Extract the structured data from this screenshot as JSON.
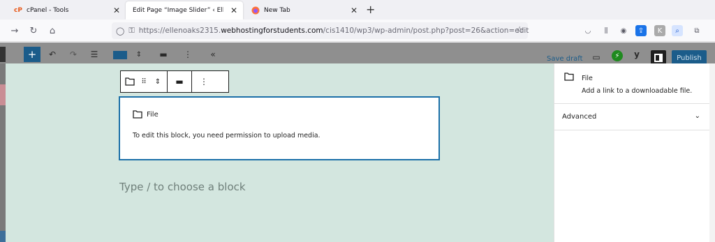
{
  "browser": {
    "tabs": [
      {
        "title": "cPanel - Tools",
        "favicon": "cpanel-icon",
        "active": false
      },
      {
        "title": "Edit Page “Image Slider” ‹ Ellen’s Po",
        "favicon": "",
        "active": true
      },
      {
        "title": "New Tab",
        "favicon": "firefox-icon",
        "active": false
      }
    ],
    "new_tab_label": "+",
    "url_prefix": "https://ellenoaks2315.",
    "url_domain": "webhostingforstudents.com",
    "url_suffix": "/cis1410/wp3/wp-admin/post.php?post=26&action=edit"
  },
  "wp_toolbar": {
    "save_draft": "Save draft",
    "publish": "Publish"
  },
  "block": {
    "title": "File",
    "message": "To edit this block, you need permission to upload media."
  },
  "appender_placeholder": "Type / to choose a block",
  "sidebar": {
    "block_name": "File",
    "block_description": "Add a link to a downloadable file.",
    "advanced_label": "Advanced"
  },
  "colors": {
    "canvas_bg": "#d3e6df",
    "wp_accent": "#1b5c8a",
    "block_border": "#1b6fa8"
  }
}
